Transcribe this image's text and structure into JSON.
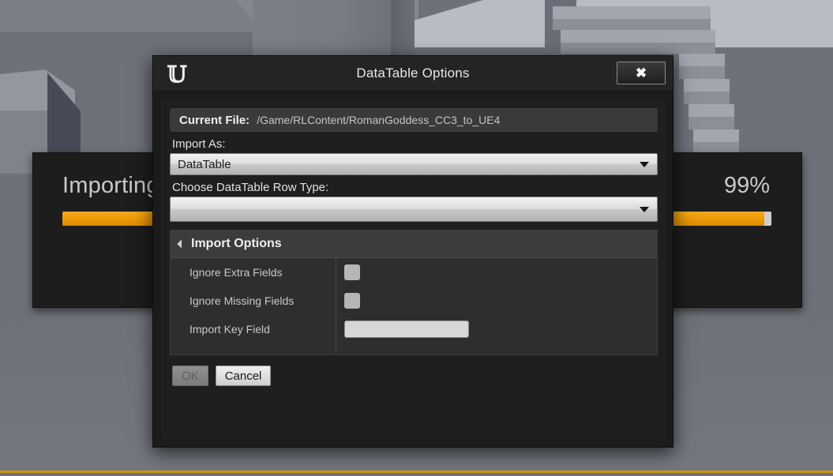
{
  "background": {
    "scene_description": "grayscale 3D editor viewport with cube, column and staircase",
    "accent_line_color": "#d0920f"
  },
  "progress_dialog": {
    "label": "Importing",
    "percent_text": "99%",
    "percent_value": 99,
    "bar_fill_color": "#f0a011",
    "bar_track_color": "#cfcfcf"
  },
  "dialog": {
    "title": "DataTable Options",
    "logo_glyph": "U",
    "close_label": "✖",
    "current_file": {
      "label": "Current File:",
      "value": "/Game/RLContent/RomanGoddess_CC3_to_UE4"
    },
    "import_as": {
      "label": "Import As:",
      "value": "DataTable"
    },
    "row_type": {
      "label": "Choose DataTable Row Type:",
      "value": ""
    },
    "import_options": {
      "header": "Import Options",
      "rows": [
        {
          "name": "Ignore Extra Fields",
          "control": "checkbox",
          "checked": false
        },
        {
          "name": "Ignore Missing Fields",
          "control": "checkbox",
          "checked": false
        },
        {
          "name": "Import Key Field",
          "control": "text",
          "value": ""
        }
      ]
    },
    "footer": {
      "ok_label": "OK",
      "ok_enabled": false,
      "cancel_label": "Cancel"
    }
  }
}
